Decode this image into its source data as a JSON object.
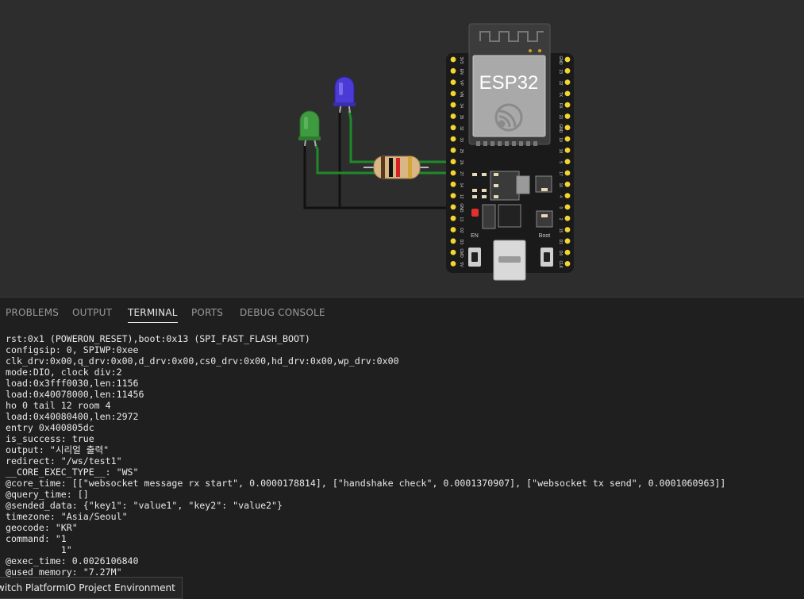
{
  "board": {
    "chip_label": "ESP32",
    "en_label": "EN",
    "boot_label": "Boot",
    "left_pins": [
      "3V3",
      "EN",
      "VP",
      "VN",
      "34",
      "35",
      "32",
      "33",
      "25",
      "26",
      "27",
      "14",
      "12",
      "GND",
      "13",
      "D2",
      "D3",
      "CMD",
      "5V"
    ],
    "right_pins": [
      "GND",
      "23",
      "22",
      "TX",
      "RX",
      "21",
      "GND",
      "19",
      "18",
      "5",
      "17",
      "16",
      "4",
      "0",
      "2",
      "15",
      "D1",
      "D0",
      "CLK"
    ]
  },
  "components": {
    "led_green_color": "#3f9b3f",
    "led_blue_color": "#4a3bd6",
    "wire_green_color": "#1f8a2a",
    "wire_black_color": "#111111"
  },
  "panel": {
    "tabs": [
      {
        "label": "PROBLEMS",
        "active": false
      },
      {
        "label": "OUTPUT",
        "active": false
      },
      {
        "label": "TERMINAL",
        "active": true
      },
      {
        "label": "PORTS",
        "active": false
      },
      {
        "label": "DEBUG CONSOLE",
        "active": false
      }
    ]
  },
  "terminal": {
    "lines": [
      "rst:0x1 (POWERON_RESET),boot:0x13 (SPI_FAST_FLASH_BOOT)",
      "configsip: 0, SPIWP:0xee",
      "clk_drv:0x00,q_drv:0x00,d_drv:0x00,cs0_drv:0x00,hd_drv:0x00,wp_drv:0x00",
      "mode:DIO, clock div:2",
      "load:0x3fff0030,len:1156",
      "load:0x40078000,len:11456",
      "ho 0 tail 12 room 4",
      "load:0x40080400,len:2972",
      "entry 0x400805dc",
      "is_success: true",
      "output: \"시리얼 출력\"",
      "redirect: \"/ws/test1\"",
      "__CORE_EXEC_TYPE__: \"WS\"",
      "@core_time: [[\"websocket message rx start\", 0.0000178814], [\"handshake check\", 0.0001370907], [\"websocket tx send\", 0.0001060963]]",
      "@query_time: []",
      "@sended_data: {\"key1\": \"value1\", \"key2\": \"value2\"}",
      "timezone: \"Asia/Seoul\"",
      "geocode: \"KR\"",
      "command: \"1",
      "          1\"",
      "@exec_time: 0.0026106840",
      "@used_memory: \"7.27M\""
    ]
  },
  "status": {
    "tooltip": "witch PlatformIO Project Environment"
  }
}
